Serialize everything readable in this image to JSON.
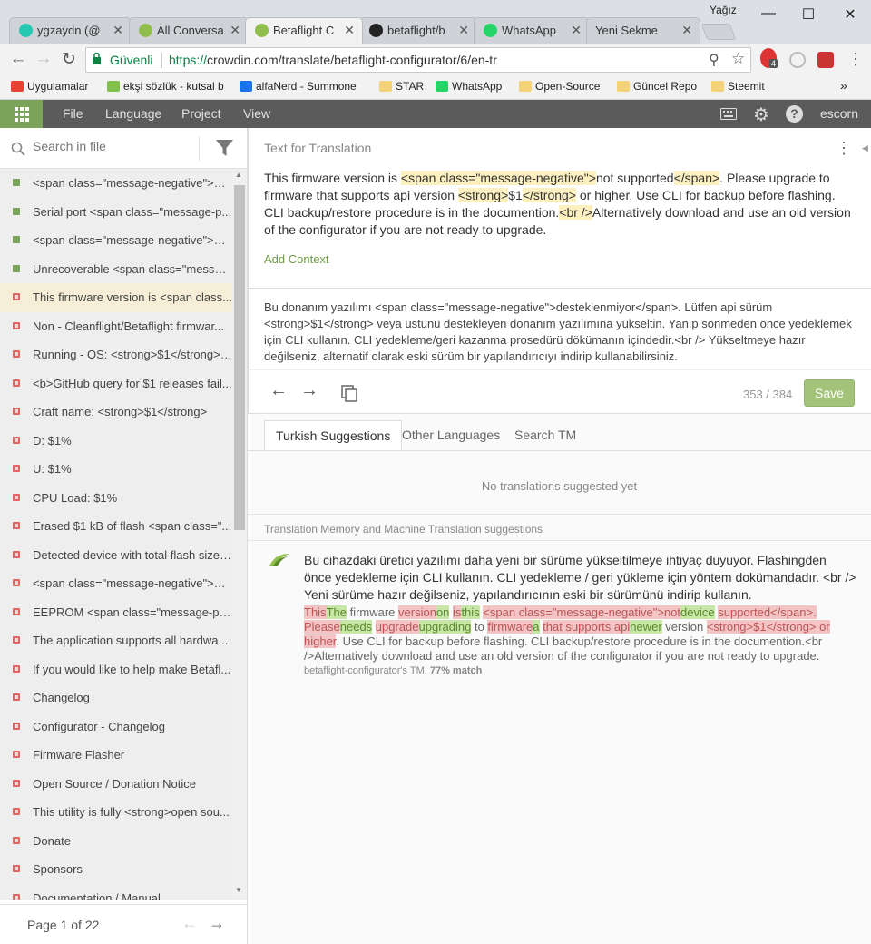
{
  "browser": {
    "tabs": [
      {
        "title": "ygzaydn (@",
        "icon_color": "#28c7b2"
      },
      {
        "title": "All Conversa",
        "icon_color": "#8fbf4a"
      },
      {
        "title": "Betaflight C",
        "icon_color": "#8fbf4a"
      },
      {
        "title": "betaflight/b",
        "icon_color": "#222222"
      },
      {
        "title": "WhatsApp",
        "icon_color": "#25d366"
      },
      {
        "title": "Yeni Sekme",
        "icon_color": ""
      }
    ],
    "window_user": "Yağız",
    "secure_label": "Güvenli",
    "url_proto": "https://",
    "url_rest": "crowdin.com/translate/betaflight-configurator/6/en-tr",
    "extension_badge": "4",
    "bookmarks": [
      {
        "label": "Uygulamalar",
        "color": "#e94235"
      },
      {
        "label": "ekşi sözlük - kutsal b",
        "color": "#81c14b"
      },
      {
        "label": "alfaNerd - Summone",
        "color": "#1a73e8"
      },
      {
        "label": "STAR",
        "color": "#f4d27a"
      },
      {
        "label": "WhatsApp",
        "color": "#25d366"
      },
      {
        "label": "Open-Source",
        "color": "#f4d27a"
      },
      {
        "label": "Güncel Repo",
        "color": "#f4d27a"
      },
      {
        "label": "Steemit",
        "color": "#f4d27a"
      }
    ],
    "bookmarks_more": "»"
  },
  "app": {
    "menu": [
      "File",
      "Language",
      "Project",
      "View"
    ],
    "username": "escorn",
    "accent": "#7ba35a"
  },
  "sidebar": {
    "search_placeholder": "Search in file",
    "items": [
      {
        "label": "<span class=\"message-negative\">Fai...",
        "status": "done"
      },
      {
        "label": "Serial port <span class=\"message-p...",
        "status": "done"
      },
      {
        "label": "<span class=\"message-negative\">Fai...",
        "status": "done"
      },
      {
        "label": "Unrecoverable <span class=\"messag...",
        "status": "done"
      },
      {
        "label": "This firmware version is <span class...",
        "status": "todo",
        "selected": true
      },
      {
        "label": "Non - Cleanflight/Betaflight firmwar...",
        "status": "todo"
      },
      {
        "label": "Running - OS: <strong>$1</strong>, ...",
        "status": "todo"
      },
      {
        "label": "<b>GitHub query for $1 releases fail...",
        "status": "todo"
      },
      {
        "label": "Craft name: <strong>$1</strong>",
        "status": "todo"
      },
      {
        "label": "D: $1%",
        "status": "todo"
      },
      {
        "label": "U: $1%",
        "status": "todo"
      },
      {
        "label": "CPU Load: $1%",
        "status": "todo"
      },
      {
        "label": "Erased $1 kB of flash <span class=\"...",
        "status": "todo"
      },
      {
        "label": "Detected device with total flash size ...",
        "status": "todo"
      },
      {
        "label": "<span class=\"message-negative\">Er...",
        "status": "todo"
      },
      {
        "label": "EEPROM <span class=\"message-posi...",
        "status": "todo"
      },
      {
        "label": "The application supports all hardwa...",
        "status": "todo"
      },
      {
        "label": "If you would like to help make Betafl...",
        "status": "todo"
      },
      {
        "label": "Changelog",
        "status": "todo"
      },
      {
        "label": "Configurator - Changelog",
        "status": "todo"
      },
      {
        "label": "Firmware Flasher",
        "status": "todo"
      },
      {
        "label": "Open Source / Donation Notice",
        "status": "todo"
      },
      {
        "label": "This utility is fully <strong>open sou...",
        "status": "todo"
      },
      {
        "label": "Donate",
        "status": "todo"
      },
      {
        "label": "Sponsors",
        "status": "todo"
      },
      {
        "label": "Documentation / Manual",
        "status": "todo"
      }
    ],
    "status_colors": {
      "done": "#7ba35a",
      "todo": "#e06666"
    },
    "pager_text": "Page 1 of 22"
  },
  "editor": {
    "source_header": "Text for Translation",
    "source_parts": [
      {
        "t": "This firmware version is ",
        "tag": false
      },
      {
        "t": "<span class=\"message-negative\">",
        "tag": true
      },
      {
        "t": "not supported",
        "tag": false
      },
      {
        "t": "</span>",
        "tag": true
      },
      {
        "t": ". Please upgrade to firmware that supports api version ",
        "tag": false
      },
      {
        "t": "<strong>",
        "tag": true
      },
      {
        "t": "$1",
        "tag": false
      },
      {
        "t": "</strong>",
        "tag": true
      },
      {
        "t": " or higher. Use CLI for backup before flashing. CLI backup/restore procedure is in the documention.",
        "tag": false
      },
      {
        "t": "<br />",
        "tag": true
      },
      {
        "t": "Alternatively download and use an old version of the configurator if you are not ready to upgrade.",
        "tag": false
      }
    ],
    "add_context": "Add Context",
    "translation": "Bu donanım yazılımı <span class=\"message-negative\">desteklenmiyor</span>. Lütfen api sürüm <strong>$1</strong> veya üstünü destekleyen donanım yazılımına yükseltin. Yanıp sönmeden önce yedeklemek için CLI kullanın. CLI yedekleme/geri kazanma prosedürü dökümanın içindedir.<br /> Yükseltmeye hazır değilseniz, alternatif olarak eski sürüm bir yapılandırıcıyı indirip kullanabilirsiniz.",
    "counter": "353 / 384",
    "save_label": "Save"
  },
  "suggestions": {
    "tabs": [
      "Turkish Suggestions",
      "Other Languages",
      "Search TM"
    ],
    "empty_text": "No translations suggested yet",
    "tm_header": "Translation Memory and Machine Translation suggestions",
    "tm_translation": "Bu cihazdaki üretici yazılımı daha yeni bir sürüme yükseltilmeye ihtiyaç duyuyor. Flashingden önce yedekleme için CLI kullanın. CLI yedekleme / geri yükleme için yöntem dokümandadır. <br /> Yeni sürüme hazır değilseniz, yapılandırıcının eski bir sürümünü indirip kullanın.",
    "tm_diff": [
      {
        "t": "This",
        "k": "del"
      },
      {
        "t": "The",
        "k": "ins"
      },
      {
        "t": " firmware ",
        "k": ""
      },
      {
        "t": "version",
        "k": "del"
      },
      {
        "t": "on",
        "k": "ins"
      },
      {
        "t": " ",
        "k": ""
      },
      {
        "t": "is",
        "k": "del"
      },
      {
        "t": "this",
        "k": "ins"
      },
      {
        "t": " ",
        "k": ""
      },
      {
        "t": "<span class=\"message-negative\">not",
        "k": "del"
      },
      {
        "t": "device",
        "k": "ins"
      },
      {
        "t": " ",
        "k": ""
      },
      {
        "t": "supported</span>. Please",
        "k": "del"
      },
      {
        "t": "needs",
        "k": "ins"
      },
      {
        "t": " ",
        "k": ""
      },
      {
        "t": "upgrade",
        "k": "del"
      },
      {
        "t": "upgrading",
        "k": "ins"
      },
      {
        "t": " to ",
        "k": ""
      },
      {
        "t": "firmware",
        "k": "del"
      },
      {
        "t": "a",
        "k": "ins"
      },
      {
        "t": " ",
        "k": ""
      },
      {
        "t": "that supports api",
        "k": "del"
      },
      {
        "t": "newer",
        "k": "ins"
      },
      {
        "t": " version ",
        "k": ""
      },
      {
        "t": "<strong>$1</strong> or higher",
        "k": "del"
      },
      {
        "t": ". Use CLI for backup before flashing. CLI backup/restore procedure is in the documention.<br />Alternatively download and use an old version of the configurator if you are not ready to upgrade.",
        "k": ""
      }
    ],
    "tm_source": "betaflight-configurator's TM, ",
    "tm_match": "77% match"
  }
}
